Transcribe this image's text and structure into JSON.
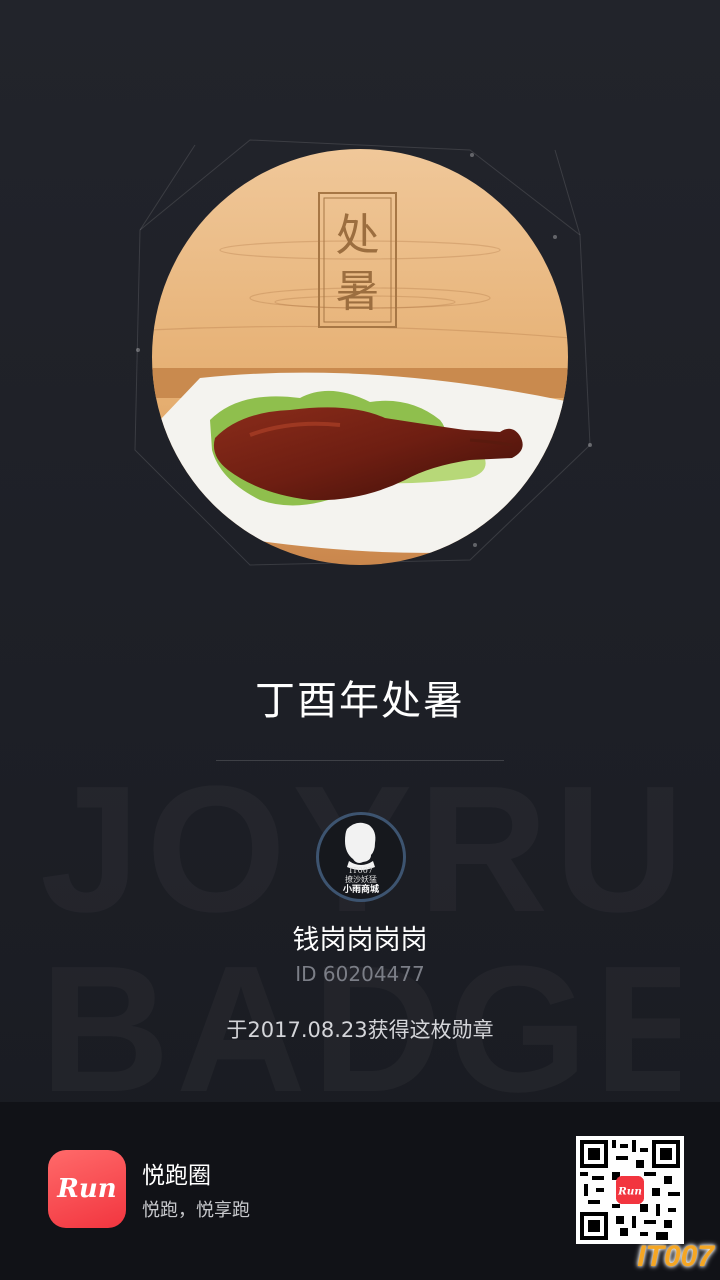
{
  "watermark": {
    "line1": "JOYRUN",
    "line2": "BADGES"
  },
  "badge": {
    "plaque_char1": "处",
    "plaque_char2": "暑",
    "title": "丁酉年处暑"
  },
  "user": {
    "avatar_line1": "IT007",
    "avatar_line2": "撩沙妖猛",
    "avatar_line3": "小雨商城",
    "name": "钱岗岗岗岗",
    "id_text": "ID 60204477",
    "earned_text": "于2017.08.23获得这枚勋章"
  },
  "footer": {
    "app_icon_text": "Run",
    "app_name": "悦跑圈",
    "app_slogan": "悦跑，悦享跑",
    "qr_center_text": "Run",
    "site_mark": "IT007"
  },
  "colors": {
    "background": "#1d1f26",
    "wood": "#e8b77e",
    "app_red": "#f2353f",
    "site_orange": "#f5a623"
  }
}
